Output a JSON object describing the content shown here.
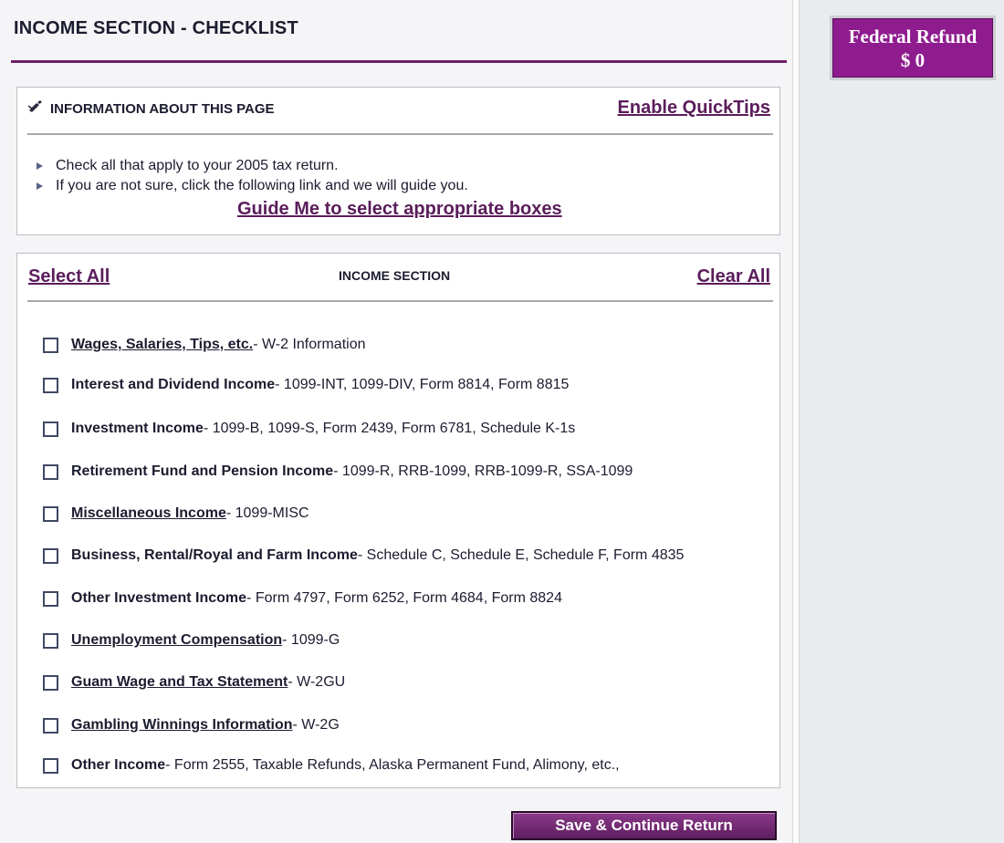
{
  "header": {
    "title": "INCOME SECTION - CHECKLIST"
  },
  "info": {
    "heading": "INFORMATION ABOUT THIS PAGE",
    "quicktips_link": "Enable QuickTips",
    "bullets": [
      "Check all that apply to your 2005 tax return.",
      "If you are not sure, click the following link and we will guide you."
    ],
    "guide_link": "Guide Me to select appropriate boxes"
  },
  "income": {
    "heading": "INCOME SECTION",
    "select_all": "Select All",
    "clear_all": "Clear All",
    "items": [
      {
        "label": "Wages, Salaries, Tips, etc.",
        "detail": " - W-2 Information",
        "link": true
      },
      {
        "label": "Interest and Dividend Income",
        "detail": " - 1099-INT, 1099-DIV, Form 8814, Form 8815",
        "link": false
      },
      {
        "label": "Investment Income",
        "detail": " - 1099-B, 1099-S, Form 2439, Form 6781, Schedule K-1s",
        "link": false
      },
      {
        "label": "Retirement Fund and Pension Income",
        "detail": " - 1099-R, RRB-1099, RRB-1099-R, SSA-1099",
        "link": false
      },
      {
        "label": "Miscellaneous Income",
        "detail": " - 1099-MISC",
        "link": true
      },
      {
        "label": "Business, Rental/Royal and Farm Income",
        "detail": " - Schedule C, Schedule E, Schedule F, Form 4835",
        "link": false
      },
      {
        "label": "Other Investment Income",
        "detail": " - Form 4797, Form 6252, Form 4684, Form 8824",
        "link": false
      },
      {
        "label": "Unemployment Compensation",
        "detail": " - 1099-G",
        "link": true
      },
      {
        "label": "Guam Wage and Tax Statement",
        "detail": " - W-2GU",
        "link": true
      },
      {
        "label": "Gambling Winnings Information",
        "detail": " - W-2G",
        "link": true
      },
      {
        "label": "Other Income",
        "detail": " - Form 2555, Taxable Refunds, Alaska Permanent Fund, Alimony, etc.,",
        "link": false
      }
    ]
  },
  "refund": {
    "label": "Federal Refund",
    "amount": "$ 0"
  },
  "footer": {
    "save_button": "Save & Continue Return"
  },
  "colors": {
    "accent": "#8f1c8f",
    "link": "#5b1d5b",
    "rule": "#6e1f6e"
  },
  "icons": {
    "info": "pen-check-icon",
    "bullet": "triangle-right-icon"
  }
}
